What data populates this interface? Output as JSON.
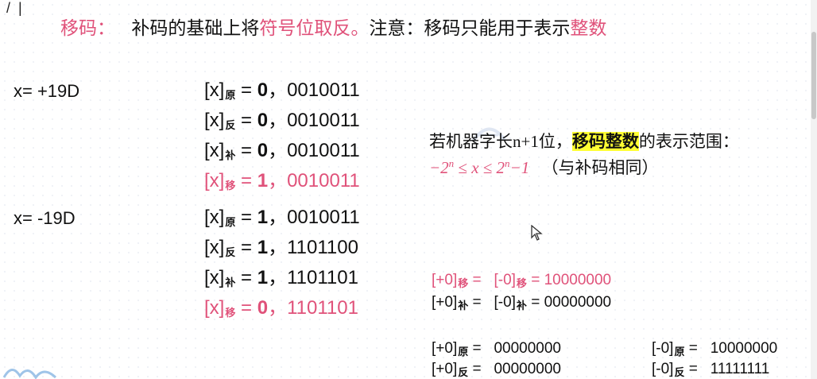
{
  "title": {
    "term": "移码：",
    "part1": "补码的基础上将",
    "emph1": "符号位取反。",
    "part2": "注意：移码只能用于表示",
    "emph2": "整数"
  },
  "positive": {
    "x_label": "x= +19D",
    "rows": [
      {
        "prefix": "[x]",
        "sub": "原",
        "eq": " = ",
        "sign": "0",
        "sep": "，",
        "bits": "0010011"
      },
      {
        "prefix": "[x]",
        "sub": "反",
        "eq": " = ",
        "sign": "0",
        "sep": "，",
        "bits": "0010011"
      },
      {
        "prefix": "[x]",
        "sub": "补",
        "eq": " = ",
        "sign": "0",
        "sep": "，",
        "bits": "0010011"
      },
      {
        "prefix": "[x]",
        "sub": "移",
        "eq": " = ",
        "sign": "1",
        "sep": "，",
        "bits": "0010011"
      }
    ]
  },
  "negative": {
    "x_label": "x= -19D",
    "rows": [
      {
        "prefix": "[x]",
        "sub": "原",
        "eq": " = ",
        "sign": "1",
        "sep": "，",
        "bits": "0010011"
      },
      {
        "prefix": "[x]",
        "sub": "反",
        "eq": " = ",
        "sign": "1",
        "sep": "，",
        "bits": "1101100"
      },
      {
        "prefix": "[x]",
        "sub": "补",
        "eq": " = ",
        "sign": "1",
        "sep": "，",
        "bits": "1101101"
      },
      {
        "prefix": "[x]",
        "sub": "移",
        "eq": " = ",
        "sign": "0",
        "sep": "，",
        "bits": "1101101"
      }
    ]
  },
  "range": {
    "line1_pre": "若机器字长n+1位，",
    "line1_hl": "移码整数",
    "line1_post": "的表示范围：",
    "formula_a": "−2",
    "formula_a_exp": "n",
    "formula_mid": " ≤ x ≤ 2",
    "formula_b_exp": "n",
    "formula_end": "−1",
    "note": "（与补码相同）"
  },
  "zeros": {
    "yi": {
      "a": "[+0]",
      "a_sub": "移",
      "eq1": " = ",
      "b": "[-0]",
      "b_sub": "移",
      "eq2": " = ",
      "val": "10000000"
    },
    "bu": {
      "a": "[+0]",
      "a_sub": "补",
      "eq1": " = ",
      "b": "[-0]",
      "b_sub": "补",
      "eq2": " = ",
      "val": "00000000"
    },
    "yuan_pos": {
      "a": "[+0]",
      "a_sub": "原",
      "eq": " = ",
      "val": "00000000"
    },
    "fan_pos": {
      "a": "[+0]",
      "a_sub": "反",
      "eq": " = ",
      "val": "00000000"
    },
    "yuan_neg": {
      "a": "[-0]",
      "a_sub": "原",
      "eq": " = ",
      "val": "10000000"
    },
    "fan_neg": {
      "a": "[-0]",
      "a_sub": "反",
      "eq": " = ",
      "val": "11111111"
    }
  },
  "colors": {
    "accent": "#e0527a",
    "highlight": "#ffff33"
  }
}
